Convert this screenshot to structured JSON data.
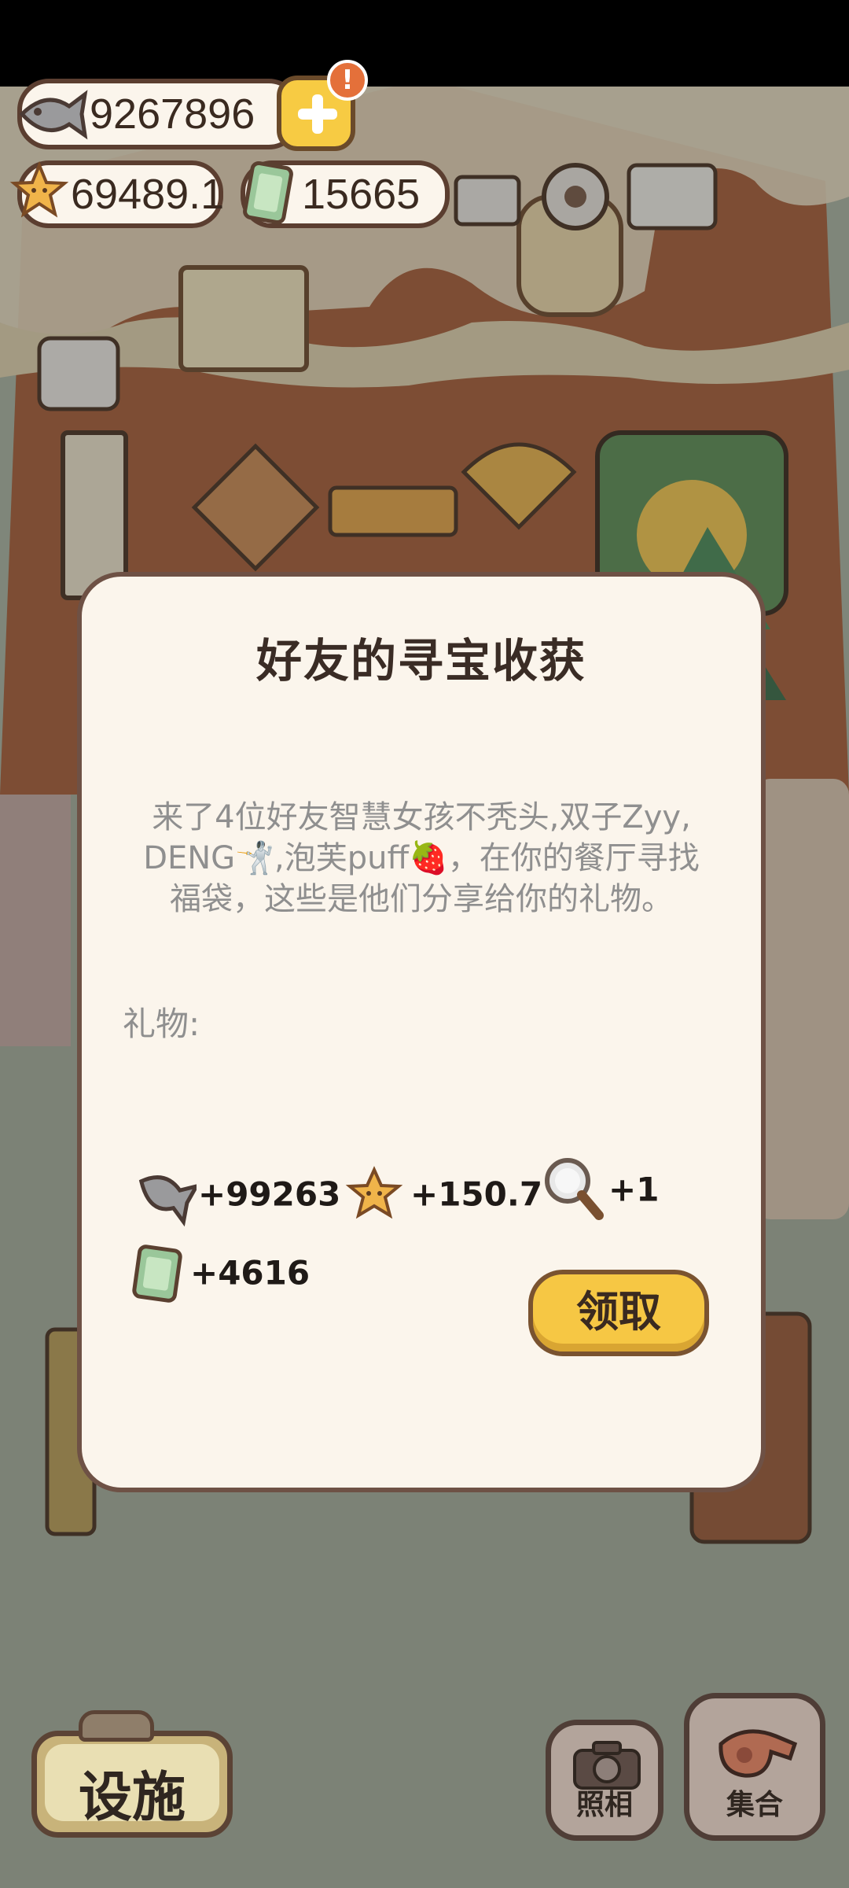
{
  "hud": {
    "fish": "9267896",
    "alert": "!",
    "stars": "69489.1",
    "cash": "15665"
  },
  "dialog": {
    "title": "好友的寻宝收获",
    "message_line1": "来了4位好友智慧女孩不秃头,双子Zyy,",
    "message_line2": "DENG🤺,泡芙puff🍓，在你的餐厅寻找",
    "message_line3": "福袋，这些是他们分享给你的礼物。",
    "gifts_label": "礼物:",
    "gifts": [
      {
        "icon": "fish-icon",
        "amount": "+99263"
      },
      {
        "icon": "star-icon",
        "amount": "+150.7"
      },
      {
        "icon": "magnifier-icon",
        "amount": "+1"
      },
      {
        "icon": "cash-icon",
        "amount": "+4616"
      }
    ],
    "claim_label": "领取"
  },
  "bottom": {
    "facilities_label": "设施",
    "photo_label": "照相",
    "gather_label": "集合"
  }
}
